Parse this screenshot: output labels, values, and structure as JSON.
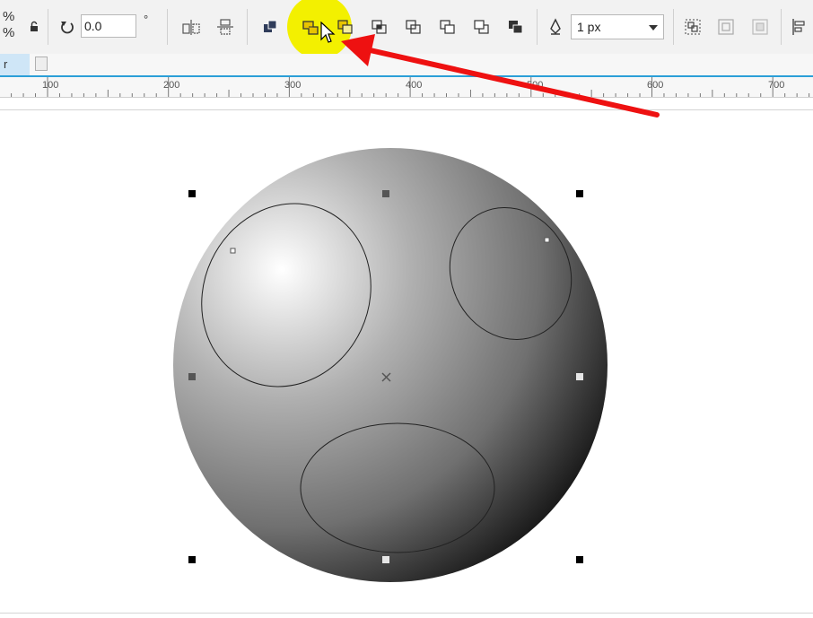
{
  "toolbar": {
    "scale_top": "%",
    "scale_bottom": "%",
    "rotation_value": "0.0",
    "rotation_unit": "°",
    "outline_width": "1 px"
  },
  "document_tab": {
    "label": "r"
  },
  "ruler": {
    "labels": [
      "100",
      "200",
      "300",
      "400",
      "500",
      "600",
      "700"
    ]
  },
  "colors": {
    "highlight": "#f3f000",
    "annotation_arrow": "#ee1111",
    "ruler_accent": "#2b9fd8"
  }
}
